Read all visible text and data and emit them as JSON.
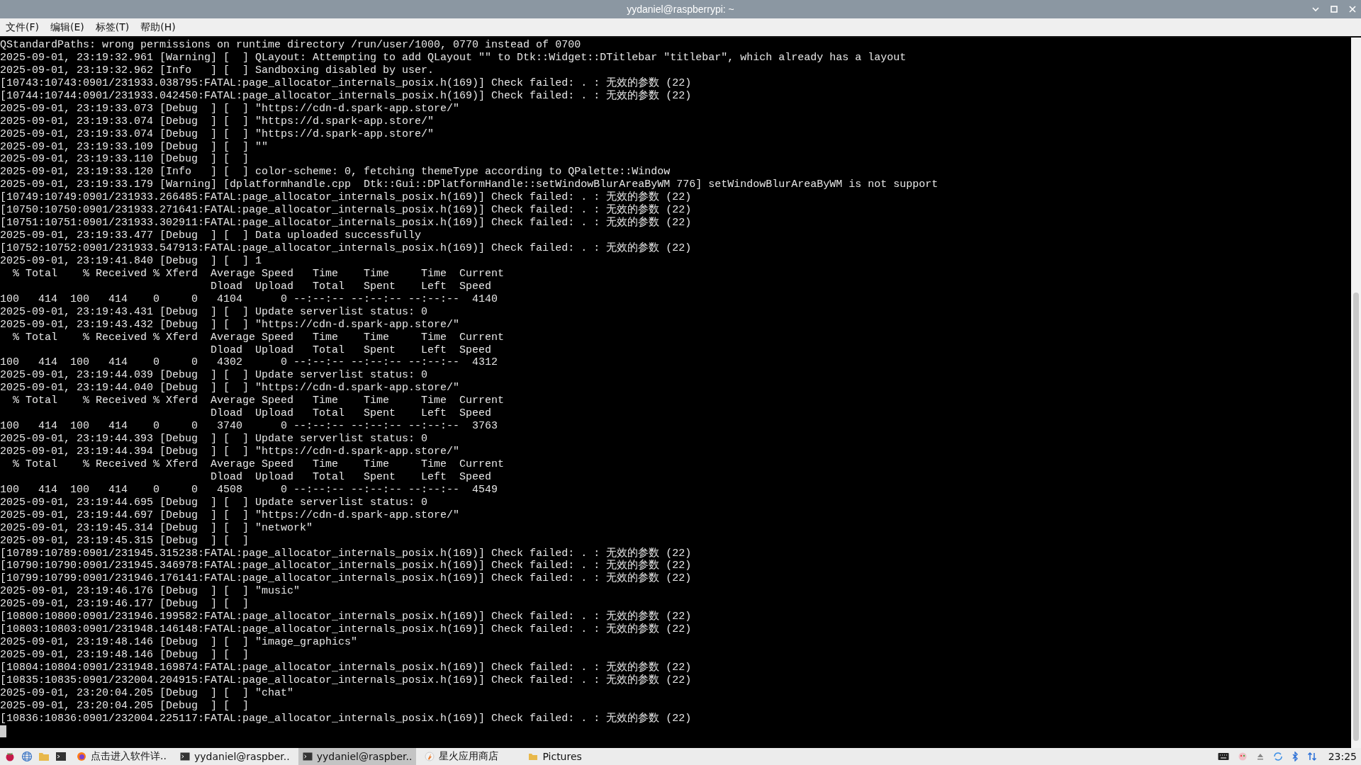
{
  "window": {
    "title": "yydaniel@raspberrypi: ~"
  },
  "menu": [
    "文件(F)",
    "编辑(E)",
    "标签(T)",
    "帮助(H)"
  ],
  "terminal": {
    "lines": [
      "QStandardPaths: wrong permissions on runtime directory /run/user/1000, 0770 instead of 0700",
      "2025-09-01, 23:19:32.961 [Warning] [  ] QLayout: Attempting to add QLayout \"\" to Dtk::Widget::DTitlebar \"titlebar\", which already has a layout",
      "2025-09-01, 23:19:32.962 [Info   ] [  ] Sandboxing disabled by user.",
      "[10743:10743:0901/231933.038795:FATAL:page_allocator_internals_posix.h(169)] Check failed: . : 无效的参数 (22)",
      "[10744:10744:0901/231933.042450:FATAL:page_allocator_internals_posix.h(169)] Check failed: . : 无效的参数 (22)",
      "2025-09-01, 23:19:33.073 [Debug  ] [  ] \"https://cdn-d.spark-app.store/\"",
      "2025-09-01, 23:19:33.074 [Debug  ] [  ] \"https://d.spark-app.store/\"",
      "2025-09-01, 23:19:33.074 [Debug  ] [  ] \"https://d.spark-app.store/\"",
      "2025-09-01, 23:19:33.109 [Debug  ] [  ] \"\"",
      "2025-09-01, 23:19:33.110 [Debug  ] [  ]",
      "2025-09-01, 23:19:33.120 [Info   ] [  ] color-scheme: 0, fetching themeType according to QPalette::Window",
      "2025-09-01, 23:19:33.179 [Warning] [dplatformhandle.cpp  Dtk::Gui::DPlatformHandle::setWindowBlurAreaByWM 776] setWindowBlurAreaByWM is not support",
      "[10749:10749:0901/231933.266485:FATAL:page_allocator_internals_posix.h(169)] Check failed: . : 无效的参数 (22)",
      "[10750:10750:0901/231933.271641:FATAL:page_allocator_internals_posix.h(169)] Check failed: . : 无效的参数 (22)",
      "[10751:10751:0901/231933.302911:FATAL:page_allocator_internals_posix.h(169)] Check failed: . : 无效的参数 (22)",
      "2025-09-01, 23:19:33.477 [Debug  ] [  ] Data uploaded successfully",
      "[10752:10752:0901/231933.547913:FATAL:page_allocator_internals_posix.h(169)] Check failed: . : 无效的参数 (22)",
      "2025-09-01, 23:19:41.840 [Debug  ] [  ] 1",
      "  % Total    % Received % Xferd  Average Speed   Time    Time     Time  Current",
      "                                 Dload  Upload   Total   Spent    Left  Speed",
      "100   414  100   414    0     0   4104      0 --:--:-- --:--:-- --:--:--  4140",
      "2025-09-01, 23:19:43.431 [Debug  ] [  ] Update serverlist status: 0",
      "2025-09-01, 23:19:43.432 [Debug  ] [  ] \"https://cdn-d.spark-app.store/\"",
      "  % Total    % Received % Xferd  Average Speed   Time    Time     Time  Current",
      "                                 Dload  Upload   Total   Spent    Left  Speed",
      "100   414  100   414    0     0   4302      0 --:--:-- --:--:-- --:--:--  4312",
      "2025-09-01, 23:19:44.039 [Debug  ] [  ] Update serverlist status: 0",
      "2025-09-01, 23:19:44.040 [Debug  ] [  ] \"https://cdn-d.spark-app.store/\"",
      "  % Total    % Received % Xferd  Average Speed   Time    Time     Time  Current",
      "                                 Dload  Upload   Total   Spent    Left  Speed",
      "100   414  100   414    0     0   3740      0 --:--:-- --:--:-- --:--:--  3763",
      "2025-09-01, 23:19:44.393 [Debug  ] [  ] Update serverlist status: 0",
      "2025-09-01, 23:19:44.394 [Debug  ] [  ] \"https://cdn-d.spark-app.store/\"",
      "  % Total    % Received % Xferd  Average Speed   Time    Time     Time  Current",
      "                                 Dload  Upload   Total   Spent    Left  Speed",
      "100   414  100   414    0     0   4508      0 --:--:-- --:--:-- --:--:--  4549",
      "2025-09-01, 23:19:44.695 [Debug  ] [  ] Update serverlist status: 0",
      "2025-09-01, 23:19:44.697 [Debug  ] [  ] \"https://cdn-d.spark-app.store/\"",
      "2025-09-01, 23:19:45.314 [Debug  ] [  ] \"network\"",
      "2025-09-01, 23:19:45.315 [Debug  ] [  ]",
      "[10789:10789:0901/231945.315238:FATAL:page_allocator_internals_posix.h(169)] Check failed: . : 无效的参数 (22)",
      "[10790:10790:0901/231945.346978:FATAL:page_allocator_internals_posix.h(169)] Check failed: . : 无效的参数 (22)",
      "[10799:10799:0901/231946.176141:FATAL:page_allocator_internals_posix.h(169)] Check failed: . : 无效的参数 (22)",
      "2025-09-01, 23:19:46.176 [Debug  ] [  ] \"music\"",
      "2025-09-01, 23:19:46.177 [Debug  ] [  ]",
      "[10800:10800:0901/231946.199582:FATAL:page_allocator_internals_posix.h(169)] Check failed: . : 无效的参数 (22)",
      "[10803:10803:0901/231948.146148:FATAL:page_allocator_internals_posix.h(169)] Check failed: . : 无效的参数 (22)",
      "2025-09-01, 23:19:48.146 [Debug  ] [  ] \"image_graphics\"",
      "2025-09-01, 23:19:48.146 [Debug  ] [  ]",
      "[10804:10804:0901/231948.169874:FATAL:page_allocator_internals_posix.h(169)] Check failed: . : 无效的参数 (22)",
      "[10835:10835:0901/232004.204915:FATAL:page_allocator_internals_posix.h(169)] Check failed: . : 无效的参数 (22)",
      "2025-09-01, 23:20:04.205 [Debug  ] [  ] \"chat\"",
      "2025-09-01, 23:20:04.205 [Debug  ] [  ]",
      "[10836:10836:0901/232004.225117:FATAL:page_allocator_internals_posix.h(169)] Check failed: . : 无效的参数 (22)"
    ]
  },
  "taskbar": {
    "tasks": [
      {
        "kind": "browser",
        "label": "点击进入软件详..",
        "selected": false
      },
      {
        "kind": "terminal",
        "label": "yydaniel@raspber..",
        "selected": false
      },
      {
        "kind": "terminal",
        "label": "yydaniel@raspber..",
        "selected": true
      },
      {
        "kind": "store",
        "label": "星火应用商店",
        "selected": false
      },
      {
        "kind": "folder",
        "label": "Pictures",
        "selected": false
      }
    ],
    "clock": "23:25"
  }
}
